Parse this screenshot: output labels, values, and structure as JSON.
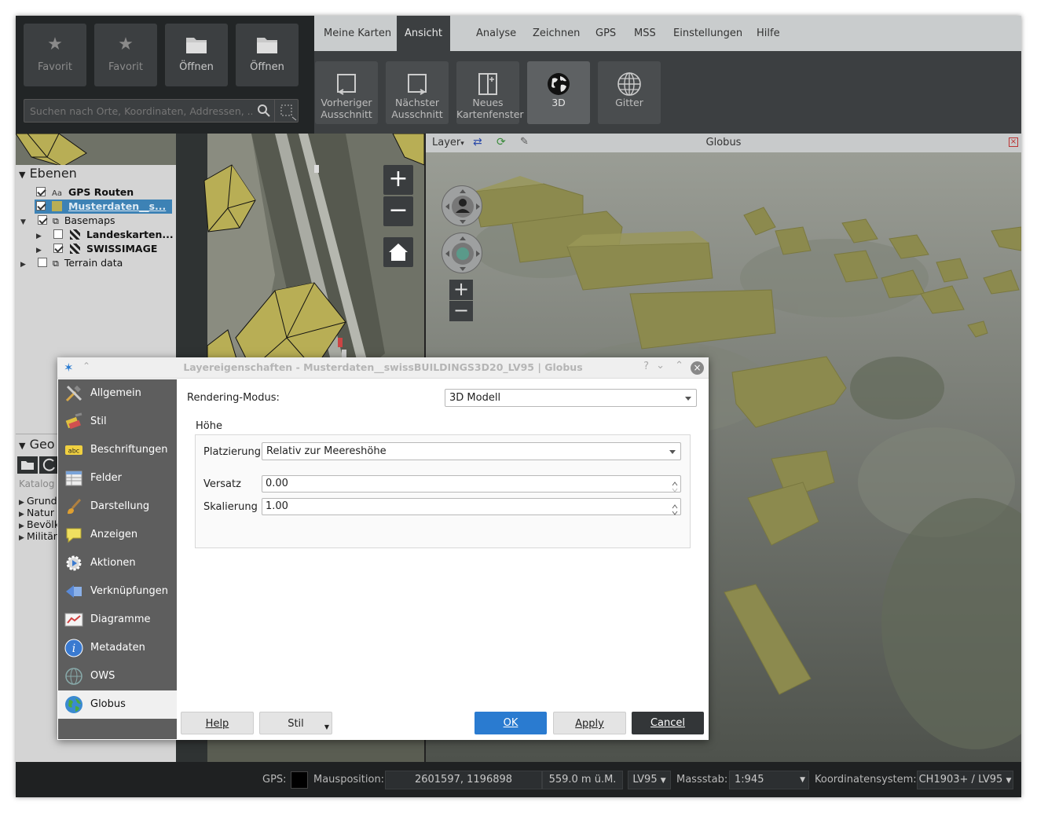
{
  "favorites": [
    {
      "label": "Favorit",
      "icon": "star-icon"
    },
    {
      "label": "Favorit",
      "icon": "star-icon"
    },
    {
      "label": "Öffnen",
      "icon": "folder-icon"
    },
    {
      "label": "Öffnen",
      "icon": "folder-icon"
    }
  ],
  "search": {
    "placeholder": "Suchen nach Orte, Koordinaten, Addressen, ..."
  },
  "ribbon": {
    "tabs": [
      "Meine Karten",
      "Ansicht",
      "Analyse",
      "Zeichnen",
      "GPS",
      "MSS",
      "Einstellungen",
      "Hilfe"
    ],
    "active_tab": "Ansicht",
    "buttons": [
      {
        "label1": "Vorheriger",
        "label2": "Ausschnitt",
        "icon": "previous-extent-icon"
      },
      {
        "label1": "Nächster",
        "label2": "Ausschnitt",
        "icon": "next-extent-icon"
      },
      {
        "label1": "Neues",
        "label2": "Kartenfenster",
        "icon": "new-map-window-icon"
      },
      {
        "label1": "3D",
        "label2": "",
        "icon": "globe-3d-icon"
      },
      {
        "label1": "Gitter",
        "label2": "",
        "icon": "grid-globe-icon"
      }
    ]
  },
  "layers_panel": {
    "title": "Ebenen",
    "items": [
      {
        "label": "GPS Routen",
        "checked": true
      },
      {
        "label": "Musterdaten__s...",
        "checked": true
      },
      {
        "label": "Basemaps",
        "checked": true
      },
      {
        "label": "Landeskarten...",
        "checked": false
      },
      {
        "label": "SWISSIMAGE",
        "checked": true
      },
      {
        "label": "Terrain data",
        "checked": false
      }
    ]
  },
  "geo_panel": {
    "title": "Geo",
    "katalog": "Katalog",
    "items": [
      "Grund",
      "Natur",
      "Bevölk",
      "Militär"
    ]
  },
  "globe": {
    "layer_label": "Layer",
    "title": "Globus"
  },
  "status": {
    "gps_label": "GPS:",
    "mouse_label": "Mausposition:",
    "mouse_value": "2601597, 1196898",
    "elevation": "559.0 m ü.M.",
    "crs_short": "LV95",
    "scale_label": "Massstab:",
    "scale_value": "1:945",
    "crs_label": "Koordinatensystem:",
    "crs_value": "CH1903+ / LV95"
  },
  "dialog": {
    "title": "Layereigenschaften - Musterdaten__swissBUILDINGS3D20_LV95 | Globus",
    "sidebar": [
      "Allgemein",
      "Stil",
      "Beschriftungen",
      "Felder",
      "Darstellung",
      "Anzeigen",
      "Aktionen",
      "Verknüpfungen",
      "Diagramme",
      "Metadaten",
      "OWS",
      "Globus"
    ],
    "active_item": "Globus",
    "rendering_label": "Rendering-Modus:",
    "rendering_value": "3D Modell",
    "height_group": "Höhe",
    "placement_label": "Platzierung",
    "placement_value": "Relativ zur Meereshöhe",
    "offset_label": "Versatz",
    "offset_value": "0.00",
    "scale_label": "Skalierung",
    "scale_value": "1.00",
    "buttons": {
      "help": "Help",
      "style": "Stil",
      "ok": "OK",
      "apply": "Apply",
      "cancel": "Cancel"
    }
  }
}
